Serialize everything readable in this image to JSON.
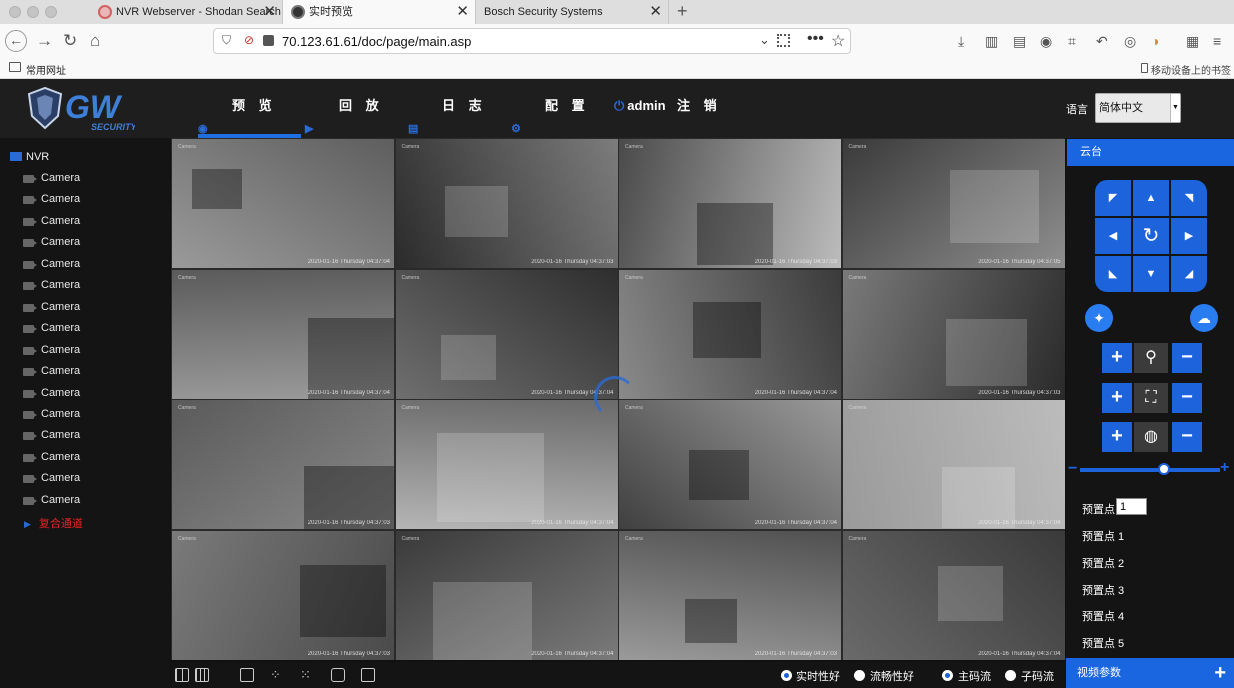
{
  "browser": {
    "tabs": [
      {
        "title": "NVR Webserver - Shodan Search"
      },
      {
        "title": "实时预览"
      },
      {
        "title": "Bosch Security Systems"
      }
    ],
    "url": "70.123.61.61/doc/page/main.asp",
    "bookmarks_left": "常用网址",
    "bookmarks_right": "移动设备上的书签"
  },
  "app": {
    "logo_text": "GW",
    "logo_sub": "SECURITY",
    "menu": {
      "preview": "预 览",
      "playback": "回 放",
      "log": "日 志",
      "config": "配 置",
      "user": "admin",
      "logout": "注 销"
    },
    "language_label": "语言",
    "language_value": "简体中文"
  },
  "sidebar": {
    "root": "NVR",
    "cameras": [
      "Camera",
      "Camera",
      "Camera",
      "Camera",
      "Camera",
      "Camera",
      "Camera",
      "Camera",
      "Camera",
      "Camera",
      "Camera",
      "Camera",
      "Camera",
      "Camera",
      "Camera",
      "Camera"
    ],
    "composite": "复合通道"
  },
  "grid": {
    "cells": [
      {
        "label": "Camera",
        "time": "2020-01-16 Thursday 04:37:04"
      },
      {
        "label": "Camera",
        "time": "2020-01-16 Thursday 04:37:03"
      },
      {
        "label": "Camera",
        "time": "2020-01-16 Thursday 04:37:03"
      },
      {
        "label": "Camera",
        "time": "2020-01-16 Thursday 04:37:05"
      },
      {
        "label": "Camera",
        "time": "2020-01-16 Thursday 04:37:04"
      },
      {
        "label": "Camera",
        "time": "2020-01-16 Thursday 04:37:04"
      },
      {
        "label": "Camera",
        "time": "2020-01-16 Thursday 04:37:04"
      },
      {
        "label": "Camera",
        "time": "2020-01-16 Thursday 04:37:03"
      },
      {
        "label": "Camera",
        "time": "2020-01-16 Thursday 04:37:03"
      },
      {
        "label": "Camera",
        "time": "2020-01-16 Thursday 04:37:04"
      },
      {
        "label": "Camera",
        "time": "2020-01-16 Thursday 04:37:04"
      },
      {
        "label": "Camera",
        "time": "2020-01-16 Thursday 04:37:04"
      },
      {
        "label": "Camera",
        "time": "2020-01-16 Thursday 04:37:03"
      },
      {
        "label": "Camera",
        "time": "2020-01-16 Thursday 04:37:04"
      },
      {
        "label": "Camera",
        "time": "2020-01-16 Thursday 04:37:03"
      },
      {
        "label": "Camera",
        "time": "2020-01-16 Thursday 04:37:04"
      }
    ]
  },
  "toolbar": {
    "realtime": "实时性好",
    "smooth": "流畅性好",
    "main_stream": "主码流",
    "sub_stream": "子码流"
  },
  "ptz": {
    "title": "云台",
    "preset_label": "预置点",
    "preset_value": "1",
    "presets": [
      "预置点 1",
      "预置点 2",
      "预置点 3",
      "预置点 4",
      "预置点 5"
    ],
    "video_params": "视频参数"
  },
  "colors": {
    "accent": "#1a66e0",
    "alert": "#e32323",
    "background": "#141414"
  }
}
